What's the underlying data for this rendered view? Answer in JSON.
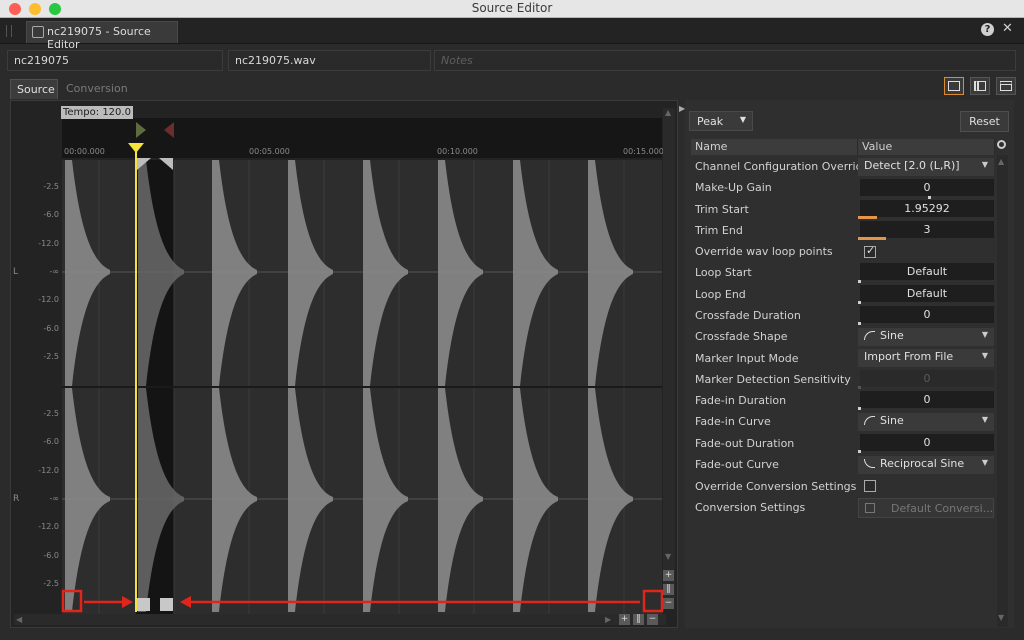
{
  "window": {
    "title": "Source Editor"
  },
  "tab": {
    "label": "nc219075 - Source Editor"
  },
  "header": {
    "name": "nc219075",
    "file": "nc219075.wav",
    "notes_placeholder": "Notes"
  },
  "subtabs": [
    "Source",
    "Conversion"
  ],
  "waveform": {
    "tempo_label": "Tempo: 120.0",
    "ruler_ticks": [
      "00:00.000",
      "00:05.000",
      "00:10.000",
      "00:15.000"
    ],
    "db_labels_l": [
      "-2.5",
      "-6.0",
      "-12.0",
      "-∞",
      "-12.0",
      "-6.0",
      "-2.5"
    ],
    "db_labels_r": [
      "-2.5",
      "-6.0",
      "-12.0",
      "-∞",
      "-12.0",
      "-6.0",
      "-2.5"
    ],
    "channel_l": "L",
    "channel_r": "R"
  },
  "props": {
    "view_mode": "Peak",
    "reset_label": "Reset",
    "col_name": "Name",
    "col_value": "Value",
    "rows": [
      {
        "name": "Channel Configuration Override",
        "value": "Detect [2.0 (L,R)]"
      },
      {
        "name": "Make-Up Gain",
        "value": "0"
      },
      {
        "name": "Trim Start",
        "value": "1.95292"
      },
      {
        "name": "Trim End",
        "value": "3"
      },
      {
        "name": "Override wav loop points",
        "value": ""
      },
      {
        "name": "Loop Start",
        "value": "Default"
      },
      {
        "name": "Loop End",
        "value": "Default"
      },
      {
        "name": "Crossfade Duration",
        "value": "0"
      },
      {
        "name": "Crossfade Shape",
        "value": "Sine"
      },
      {
        "name": "Marker Input Mode",
        "value": "Import From File"
      },
      {
        "name": "Marker Detection Sensitivity",
        "value": "0"
      },
      {
        "name": "Fade-in Duration",
        "value": "0"
      },
      {
        "name": "Fade-in Curve",
        "value": "Sine"
      },
      {
        "name": "Fade-out Duration",
        "value": "0"
      },
      {
        "name": "Fade-out Curve",
        "value": "Reciprocal Sine"
      },
      {
        "name": "Override Conversion Settings",
        "value": ""
      },
      {
        "name": "Conversion Settings",
        "value": "Default Conversi..."
      }
    ]
  },
  "state": {
    "override_wav_loop_points_checked": true,
    "override_conversion_checked": false
  },
  "colors": {
    "accent": "#e3964a",
    "playhead": "#f5e23a",
    "annotation": "#e2251b"
  }
}
